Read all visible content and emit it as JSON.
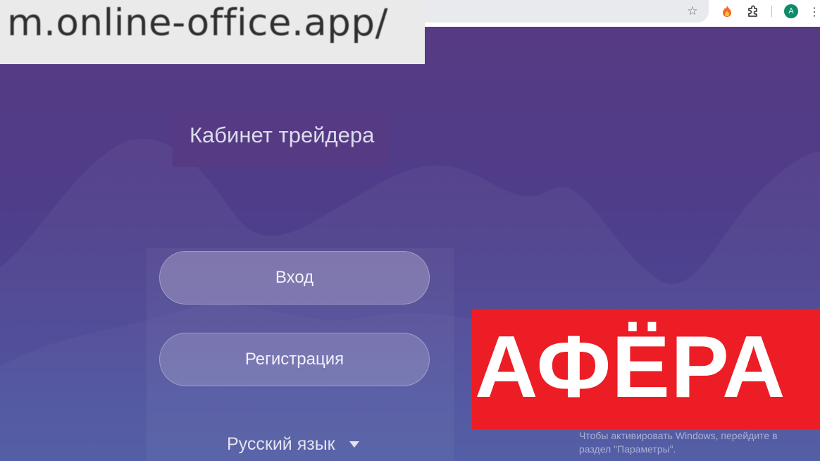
{
  "browser": {
    "url_zoomed": "m.online-office.app/",
    "profile_initial": "A",
    "icons": {
      "bookmark": "star-icon",
      "extension_1": "flame-extension-icon",
      "extensions": "puzzle-icon",
      "menu": "kebab-menu-icon"
    }
  },
  "page": {
    "title": "Кабинет трейдера",
    "login_label": "Вход",
    "register_label": "Регистрация",
    "language": "Русский язык"
  },
  "overlay": {
    "stamp_text": "АФЁРА",
    "stamp_color": "#ec1d24"
  },
  "windows_activation": {
    "line1": "Чтобы активировать Windows, перейдите в",
    "line2": "раздел \"Параметры\"."
  },
  "colors": {
    "background_top": "#573a82",
    "background_bottom": "#4753a0",
    "avatar": "#0f8a6a"
  }
}
